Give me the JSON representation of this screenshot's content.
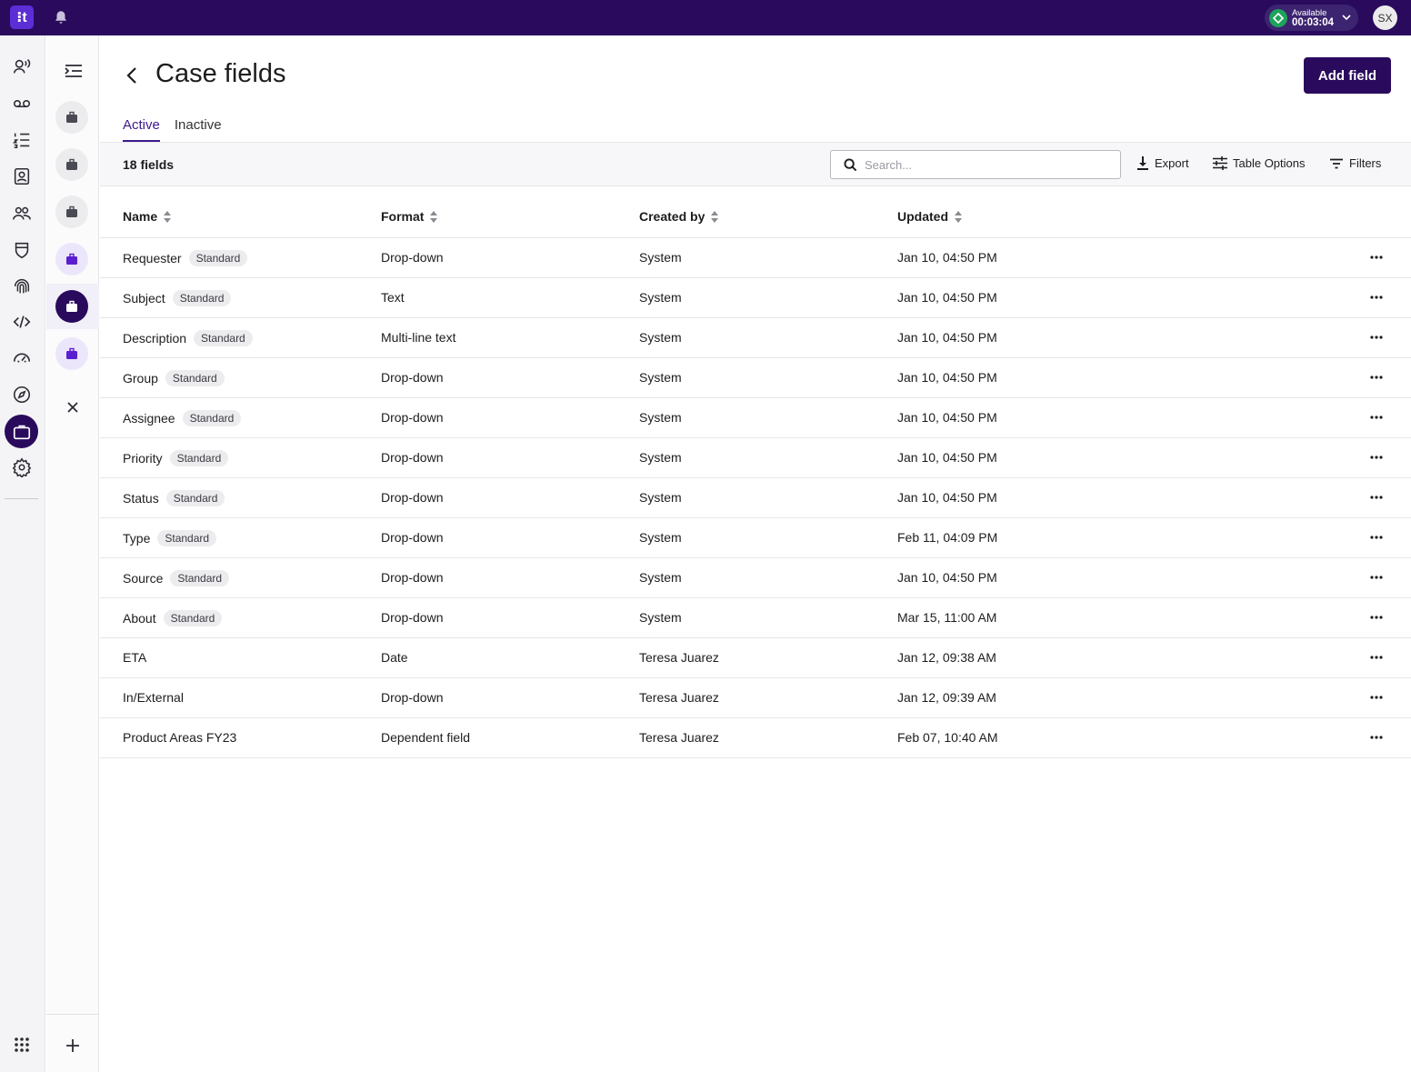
{
  "topbar": {
    "logo_glyph": "⁝t",
    "status_label": "Available",
    "status_timer": "00:03:04",
    "avatar_initials": "SX"
  },
  "rail": {
    "icons": [
      "voice-agent-icon",
      "voicemail-icon",
      "list-icon",
      "contacts-icon",
      "people-icon",
      "shield-icon",
      "fingerprint-icon",
      "code-icon",
      "speed-icon",
      "compass-icon",
      "briefcase-icon",
      "gear-icon"
    ],
    "active_icon": "briefcase-icon",
    "apps_icon": "apps-grid-icon"
  },
  "page": {
    "title": "Case fields",
    "add_button": "Add field",
    "tabs": [
      {
        "label": "Active",
        "active": true
      },
      {
        "label": "Inactive",
        "active": false
      }
    ]
  },
  "toolbar": {
    "count": "18 fields",
    "search_placeholder": "Search...",
    "export_label": "Export",
    "table_options_label": "Table Options",
    "filters_label": "Filters"
  },
  "table": {
    "columns": [
      "Name",
      "Format",
      "Created by",
      "Updated"
    ],
    "rows": [
      {
        "name": "Requester",
        "badge": "Standard",
        "format": "Drop-down",
        "created_by": "System",
        "updated": "Jan 10, 04:50 PM"
      },
      {
        "name": "Subject",
        "badge": "Standard",
        "format": "Text",
        "created_by": "System",
        "updated": "Jan 10, 04:50 PM"
      },
      {
        "name": "Description",
        "badge": "Standard",
        "format": "Multi-line text",
        "created_by": "System",
        "updated": "Jan 10, 04:50 PM"
      },
      {
        "name": "Group",
        "badge": "Standard",
        "format": "Drop-down",
        "created_by": "System",
        "updated": "Jan 10, 04:50 PM"
      },
      {
        "name": "Assignee",
        "badge": "Standard",
        "format": "Drop-down",
        "created_by": "System",
        "updated": "Jan 10, 04:50 PM"
      },
      {
        "name": "Priority",
        "badge": "Standard",
        "format": "Drop-down",
        "created_by": "System",
        "updated": "Jan 10, 04:50 PM"
      },
      {
        "name": "Status",
        "badge": "Standard",
        "format": "Drop-down",
        "created_by": "System",
        "updated": "Jan 10, 04:50 PM"
      },
      {
        "name": "Type",
        "badge": "Standard",
        "format": "Drop-down",
        "created_by": "System",
        "updated": "Feb 11, 04:09 PM"
      },
      {
        "name": "Source",
        "badge": "Standard",
        "format": "Drop-down",
        "created_by": "System",
        "updated": "Jan 10, 04:50 PM"
      },
      {
        "name": "About",
        "badge": "Standard",
        "format": "Drop-down",
        "created_by": "System",
        "updated": "Mar 15, 11:00 AM"
      },
      {
        "name": "ETA",
        "badge": "",
        "format": "Date",
        "created_by": "Teresa Juarez",
        "updated": "Jan 12, 09:38 AM"
      },
      {
        "name": "In/External",
        "badge": "",
        "format": "Drop-down",
        "created_by": "Teresa Juarez",
        "updated": "Jan 12, 09:39 AM"
      },
      {
        "name": "Product Areas FY23",
        "badge": "",
        "format": "Dependent field",
        "created_by": "Teresa Juarez",
        "updated": "Feb 07, 10:40 AM"
      }
    ]
  },
  "colors": {
    "brand_dark": "#2a0a5c",
    "accent": "#3d1a8c",
    "status_green": "#1fa35b"
  }
}
